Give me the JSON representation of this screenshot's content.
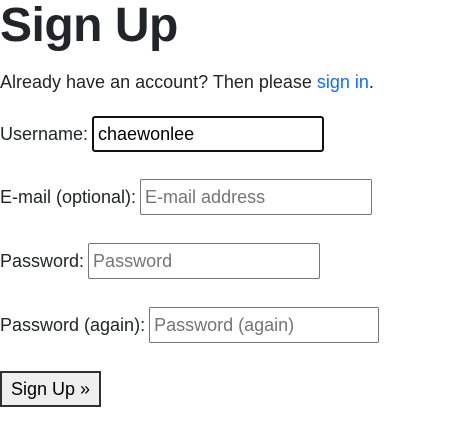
{
  "page": {
    "title": "Sign Up",
    "intro_text": "Already have an account? Then please ",
    "signin_link": "sign in",
    "intro_end": "."
  },
  "form": {
    "username": {
      "label": "Username:",
      "value": "chaewonlee",
      "placeholder": ""
    },
    "email": {
      "label": "E-mail (optional):",
      "value": "",
      "placeholder": "E-mail address"
    },
    "password": {
      "label": "Password:",
      "value": "",
      "placeholder": "Password"
    },
    "password_again": {
      "label": "Password (again):",
      "value": "",
      "placeholder": "Password (again)"
    },
    "submit_label": "Sign Up »"
  },
  "colors": {
    "link": "#0d6efd",
    "text": "#212529"
  }
}
